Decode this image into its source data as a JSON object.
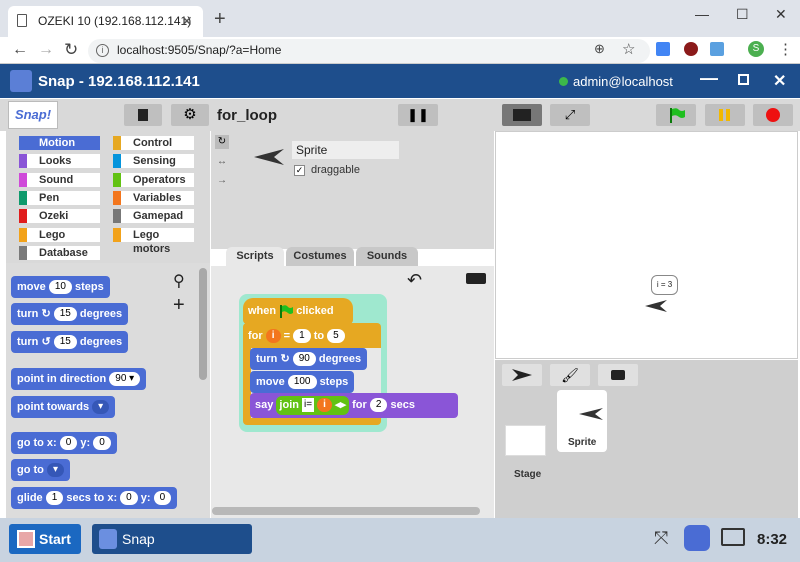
{
  "browser": {
    "tab_title": "OZEKI 10 (192.168.112.141)",
    "url": "localhost:9505/Snap/?a=Home",
    "minimize": "—",
    "maximize": "☐",
    "close": "✕"
  },
  "snap_window": {
    "title": "Snap - 192.168.112.141",
    "user": "admin@localhost",
    "status_color": "#3cb84a"
  },
  "toolbar": {
    "project_name": "for_loop"
  },
  "categories": [
    {
      "label": "Motion",
      "color": "#4a6cd4"
    },
    {
      "label": "Control",
      "color": "#e6a822"
    },
    {
      "label": "Looks",
      "color": "#8a55d7"
    },
    {
      "label": "Sensing",
      "color": "#0494dc"
    },
    {
      "label": "Sound",
      "color": "#cf4ad9"
    },
    {
      "label": "Operators",
      "color": "#62c213"
    },
    {
      "label": "Pen",
      "color": "#0e9a6c"
    },
    {
      "label": "Variables",
      "color": "#f3761d"
    },
    {
      "label": "Ozeki",
      "color": "#e01c1c"
    },
    {
      "label": "Gamepad",
      "color": "#777777"
    },
    {
      "label": "Lego",
      "color": "#f2a21a"
    },
    {
      "label": "Lego motors",
      "color": "#f2a21a"
    },
    {
      "label": "Database",
      "color": "#7a7a7a"
    }
  ],
  "palette": {
    "move": {
      "label": "move",
      "value": "10",
      "suffix": "steps"
    },
    "turn_right": {
      "label": "turn",
      "value": "15",
      "suffix": "degrees"
    },
    "turn_left": {
      "label": "turn",
      "value": "15",
      "suffix": "degrees"
    },
    "point_dir": {
      "label": "point in direction",
      "value": "90"
    },
    "point_towards": {
      "label": "point towards"
    },
    "goto_xy": {
      "label": "go to x:",
      "x": "0",
      "ylabel": "y:",
      "y": "0"
    },
    "goto": {
      "label": "go to"
    },
    "glide": {
      "label": "glide",
      "value": "1",
      "mid": "secs to x:",
      "x": "0",
      "ylabel": "y:",
      "y": "0"
    }
  },
  "sprite": {
    "name": "Sprite",
    "draggable_label": "draggable"
  },
  "tabs": {
    "scripts": "Scripts",
    "costumes": "Costumes",
    "sounds": "Sounds"
  },
  "script": {
    "hat_when": "when",
    "hat_clicked": "clicked",
    "for_label": "for",
    "for_var": "i",
    "for_eq": "=",
    "for_from": "1",
    "for_to_label": "to",
    "for_to": "5",
    "turn_label": "turn",
    "turn_value": "90",
    "turn_suffix": "degrees",
    "move_label": "move",
    "move_value": "100",
    "move_suffix": "steps",
    "say_label": "say",
    "join_label": "join",
    "join_text": "i=",
    "join_var": "i",
    "say_for": "for",
    "say_secs_value": "2",
    "say_secs": "secs"
  },
  "stage": {
    "speech_bubble": "i = 3"
  },
  "corral": {
    "stage_label": "Stage",
    "sprite_label": "Sprite"
  },
  "taskbar": {
    "start": "Start",
    "app": "Snap",
    "time": "8:32"
  }
}
